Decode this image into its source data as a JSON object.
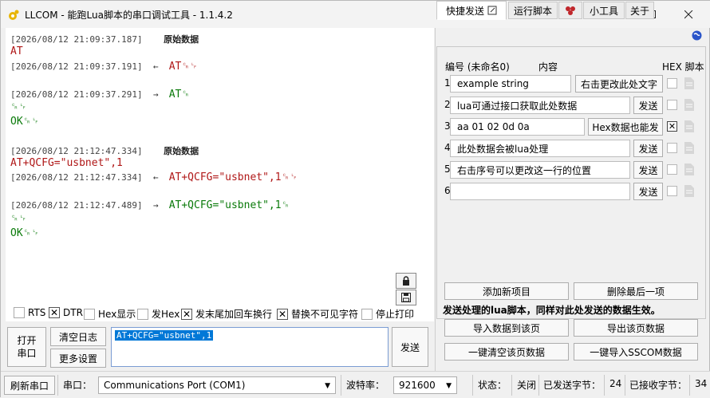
{
  "window": {
    "title": "LLCOM - 能跑Lua脚本的串口调试工具 - 1.1.4.2"
  },
  "log": [
    {
      "ts": "[2026/08/12 21:09:37.187]",
      "label": "原始数据"
    },
    {
      "data": "AT"
    },
    {
      "ts": "[2026/08/12 21:09:37.191]",
      "dir": "←",
      "data": "AT␍␊"
    },
    {
      "ts": "[2026/08/12 21:09:37.291]",
      "dir": "→",
      "data": "AT␍"
    },
    {
      "data": "␍␊"
    },
    {
      "data": "OK␍␊"
    },
    {
      "ts": "[2026/08/12 21:12:47.334]",
      "label": "原始数据"
    },
    {
      "data": "AT+QCFG=\"usbnet\",1"
    },
    {
      "ts": "[2026/08/12 21:12:47.334]",
      "dir": "←",
      "data": "AT+QCFG=\"usbnet\",1␍␊"
    },
    {
      "ts": "[2026/08/12 21:12:47.489]",
      "dir": "→",
      "data": "AT+QCFG=\"usbnet\",1␍"
    },
    {
      "data": "␍␊"
    },
    {
      "data": "OK␍␊"
    }
  ],
  "options": [
    {
      "label": "RTS",
      "checked": false
    },
    {
      "label": "DTR",
      "checked": true
    },
    {
      "label": "Hex显示",
      "checked": false
    },
    {
      "label": "发Hex",
      "checked": false
    },
    {
      "label": "发末尾加回车换行",
      "checked": true
    },
    {
      "label": "替换不可见字符",
      "checked": true
    },
    {
      "label": "停止打印",
      "checked": false
    }
  ],
  "buttons": {
    "open_port": "打开\n串口",
    "clear_log": "清空日志",
    "more_settings": "更多设置",
    "send": "发送"
  },
  "send_input": {
    "value": "AT+QCFG=\"usbnet\",1"
  },
  "tabs": [
    {
      "label": "快捷发送",
      "active": true
    },
    {
      "label": "运行脚本",
      "active": false
    },
    {
      "label": "",
      "active": false
    },
    {
      "label": "小工具",
      "active": false
    },
    {
      "label": "关于",
      "active": false
    }
  ],
  "quick_header": {
    "name": "编号 (未命名0)",
    "content": "内容",
    "hex": "HEX 脚本"
  },
  "quick_rows": [
    {
      "n": "1",
      "text": "example string",
      "btn": "右击更改此处文字",
      "hex": false
    },
    {
      "n": "2",
      "text": "lua可通过接口获取此处数据",
      "btn": "发送",
      "hex": false
    },
    {
      "n": "3",
      "text": "aa 01 02 0d 0a",
      "btn": "Hex数据也能发",
      "hex": true
    },
    {
      "n": "4",
      "text": "此处数据会被lua处理",
      "btn": "发送",
      "hex": false
    },
    {
      "n": "5",
      "text": "右击序号可以更改这一行的位置",
      "btn": "发送",
      "hex": false
    },
    {
      "n": "6",
      "text": "",
      "btn": "发送",
      "hex": false
    }
  ],
  "quick_actions": {
    "add": "添加新项目",
    "delete_last": "删除最后一项",
    "note": "发送处理的lua脚本，同样对此处发送的数据生效。",
    "import_page": "导入数据到该页",
    "export_page": "导出该页数据",
    "clear_page": "一键清空该页数据",
    "import_sscom": "一键导入SSCOM数据"
  },
  "status": {
    "refresh": "刷新串口",
    "port_label": "串口：",
    "port_value": "Communications Port (COM1)",
    "baud_label": "波特率：",
    "baud_value": "921600",
    "state_label": "状态：",
    "state_value": "关闭",
    "sent_label": "已发送字节：",
    "sent_value": "24",
    "recv_label": "已接收字节：",
    "recv_value": "34"
  },
  "colors": {
    "accent": "#0078d7",
    "rx_red": "#b01818",
    "tx_green": "#0a7a0a"
  }
}
